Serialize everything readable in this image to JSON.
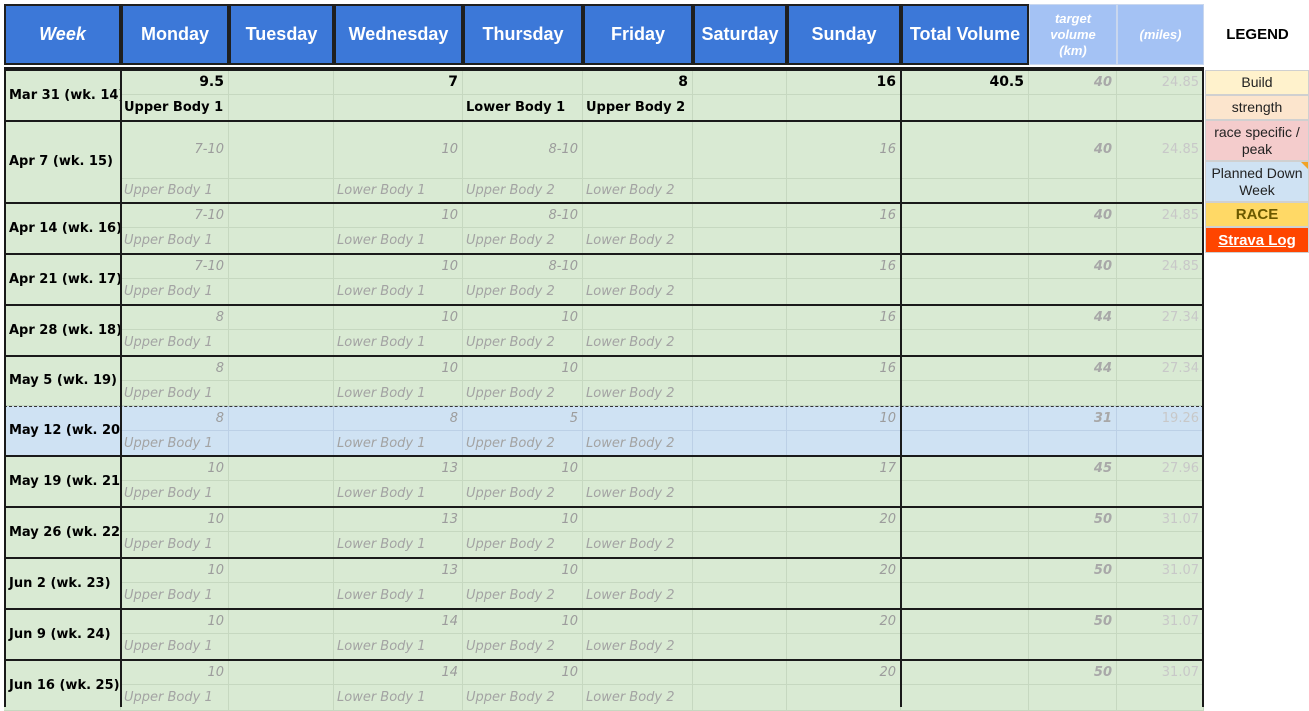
{
  "headers": {
    "week": "Week",
    "monday": "Monday",
    "tuesday": "Tuesday",
    "wednesday": "Wednesday",
    "thursday": "Thursday",
    "friday": "Friday",
    "saturday": "Saturday",
    "sunday": "Sunday",
    "total_volume": "Total Volume",
    "target_volume": "target volume (km)",
    "miles": "(miles)",
    "legend": "LEGEND"
  },
  "legend": [
    {
      "label": "Build",
      "color": "#fff2cc"
    },
    {
      "label": "strength",
      "color": "#fce5cd"
    },
    {
      "label": "race specific / peak",
      "color": "#f4cccc"
    },
    {
      "label": "Planned Down Week",
      "color": "#cfe2f3"
    },
    {
      "label": "RACE",
      "color": "#ffd966"
    },
    {
      "label": "Strava Log",
      "color": "#ff4500"
    }
  ],
  "weeks": [
    {
      "week": "Mar 31 (wk. 14)",
      "mon": "9.5",
      "wed": "7",
      "thu": "",
      "fri": "8",
      "sun": "16",
      "total": "40.5",
      "target": "40",
      "miles": "24.85",
      "mon_s": "Upper Body 1",
      "wed_s": "",
      "thu_s": "Lower Body 1",
      "fri_s": "Upper Body 2",
      "actual": true
    },
    {
      "week": "Apr 7 (wk. 15)",
      "mon": "7-10",
      "wed": "10",
      "thu": "8-10",
      "fri": "",
      "sun": "16",
      "total": "",
      "target": "40",
      "miles": "24.85",
      "mon_s": "Upper Body 1",
      "wed_s": "Lower Body 1",
      "thu_s": "Upper Body 2",
      "fri_s": "Lower Body 2"
    },
    {
      "week": "Apr 14 (wk. 16)",
      "mon": "7-10",
      "wed": "10",
      "thu": "8-10",
      "fri": "",
      "sun": "16",
      "total": "",
      "target": "40",
      "miles": "24.85",
      "mon_s": "Upper Body 1",
      "wed_s": "Lower Body 1",
      "thu_s": "Upper Body 2",
      "fri_s": "Lower Body 2"
    },
    {
      "week": "Apr 21 (wk. 17)",
      "mon": "7-10",
      "wed": "10",
      "thu": "8-10",
      "fri": "",
      "sun": "16",
      "total": "",
      "target": "40",
      "miles": "24.85",
      "mon_s": "Upper Body 1",
      "wed_s": "Lower Body 1",
      "thu_s": "Upper Body 2",
      "fri_s": "Lower Body 2"
    },
    {
      "week": "Apr 28 (wk. 18)",
      "mon": "8",
      "wed": "10",
      "thu": "10",
      "fri": "",
      "sun": "16",
      "total": "",
      "target": "44",
      "miles": "27.34",
      "mon_s": "Upper Body 1",
      "wed_s": "Lower Body 1",
      "thu_s": "Upper Body 2",
      "fri_s": "Lower Body 2"
    },
    {
      "week": "May 5 (wk. 19)",
      "mon": "8",
      "wed": "10",
      "thu": "10",
      "fri": "",
      "sun": "16",
      "total": "",
      "target": "44",
      "miles": "27.34",
      "mon_s": "Upper Body 1",
      "wed_s": "Lower Body 1",
      "thu_s": "Upper Body 2",
      "fri_s": "Lower Body 2"
    },
    {
      "week": "May 12 (wk. 20)",
      "mon": "8",
      "wed": "8",
      "thu": "5",
      "fri": "",
      "sun": "10",
      "total": "",
      "target": "31",
      "miles": "19.26",
      "mon_s": "Upper Body 1",
      "wed_s": "Lower Body 1",
      "thu_s": "Upper Body 2",
      "fri_s": "Lower Body 2",
      "down": true
    },
    {
      "week": "May 19 (wk. 21)",
      "mon": "10",
      "wed": "13",
      "thu": "10",
      "fri": "",
      "sun": "17",
      "total": "",
      "target": "45",
      "miles": "27.96",
      "mon_s": "Upper Body 1",
      "wed_s": "Lower Body 1",
      "thu_s": "Upper Body 2",
      "fri_s": "Lower Body 2"
    },
    {
      "week": "May 26 (wk. 22)",
      "mon": "10",
      "wed": "13",
      "thu": "10",
      "fri": "",
      "sun": "20",
      "total": "",
      "target": "50",
      "miles": "31.07",
      "mon_s": "Upper Body 1",
      "wed_s": "Lower Body 1",
      "thu_s": "Upper Body 2",
      "fri_s": "Lower Body 2"
    },
    {
      "week": "Jun 2 (wk. 23)",
      "mon": "10",
      "wed": "13",
      "thu": "10",
      "fri": "",
      "sun": "20",
      "total": "",
      "target": "50",
      "miles": "31.07",
      "mon_s": "Upper Body 1",
      "wed_s": "Lower Body 1",
      "thu_s": "Upper Body 2",
      "fri_s": "Lower Body 2"
    },
    {
      "week": "Jun 9 (wk. 24)",
      "mon": "10",
      "wed": "14",
      "thu": "10",
      "fri": "",
      "sun": "20",
      "total": "",
      "target": "50",
      "miles": "31.07",
      "mon_s": "Upper Body 1",
      "wed_s": "Lower Body 1",
      "thu_s": "Upper Body 2",
      "fri_s": "Lower Body 2"
    },
    {
      "week": "Jun 16 (wk. 25)",
      "mon": "10",
      "wed": "14",
      "thu": "10",
      "fri": "",
      "sun": "20",
      "total": "",
      "target": "50",
      "miles": "31.07",
      "mon_s": "Upper Body 1",
      "wed_s": "Lower Body 1",
      "thu_s": "Upper Body 2",
      "fri_s": "Lower Body 2"
    }
  ]
}
